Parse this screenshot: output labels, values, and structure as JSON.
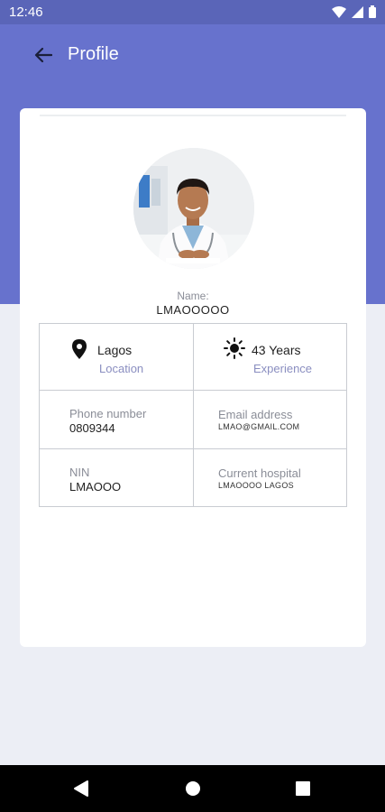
{
  "status_bar": {
    "time": "12:46"
  },
  "header": {
    "title": "Profile"
  },
  "profile": {
    "name_label": "Name:",
    "name_value": "LMAOOOOO",
    "location": {
      "value": "Lagos",
      "label": "Location"
    },
    "experience": {
      "value": "43 Years",
      "label": "Experience"
    },
    "phone": {
      "label": "Phone number",
      "value": "0809344"
    },
    "email": {
      "label": "Email address",
      "value": "LMAO@GMAIL.COM"
    },
    "nin": {
      "label": "NIN",
      "value": "LMAOOO"
    },
    "hospital": {
      "label": "Current hospital",
      "value": "LMAOOOO LAGOS"
    }
  },
  "colors": {
    "header": "#6772cd",
    "status_bar": "#5a65b8",
    "background": "#eceef5",
    "accent_label": "#8a8ec0"
  },
  "icons": [
    "wifi-icon",
    "signal-icon",
    "battery-icon",
    "back-arrow-icon",
    "location-pin-icon",
    "sun-icon",
    "nav-back-icon",
    "nav-home-icon",
    "nav-recents-icon"
  ]
}
